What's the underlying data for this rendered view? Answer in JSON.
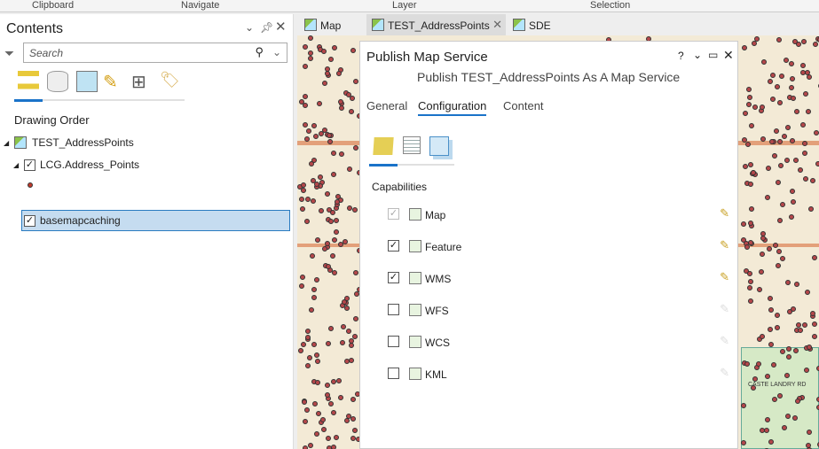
{
  "ribbon": {
    "groups": [
      "Clipboard",
      "Navigate",
      "Layer",
      "Selection"
    ]
  },
  "contents": {
    "title": "Contents",
    "search_placeholder": "Search",
    "heading": "Drawing Order",
    "tree": {
      "map": "TEST_AddressPoints",
      "layer": "LCG.Address_Points",
      "basemap": "basemapcaching"
    }
  },
  "tabs": [
    {
      "label": "Map"
    },
    {
      "label": "TEST_AddressPoints"
    },
    {
      "label": "SDE"
    }
  ],
  "pane": {
    "title": "Publish Map Service",
    "subtitle": "Publish TEST_AddressPoints As A Map Service",
    "tabs": [
      "General",
      "Configuration",
      "Content"
    ],
    "active_tab": "Configuration",
    "capabilities_heading": "Capabilities",
    "capabilities": [
      {
        "label": "Map",
        "checked": true,
        "disabled": true
      },
      {
        "label": "Feature",
        "checked": true
      },
      {
        "label": "WMS",
        "checked": true
      },
      {
        "label": "WFS",
        "checked": false
      },
      {
        "label": "WCS",
        "checked": false
      },
      {
        "label": "KML",
        "checked": false
      }
    ]
  },
  "map": {
    "road_label": "CASTE LANDRY RD"
  }
}
